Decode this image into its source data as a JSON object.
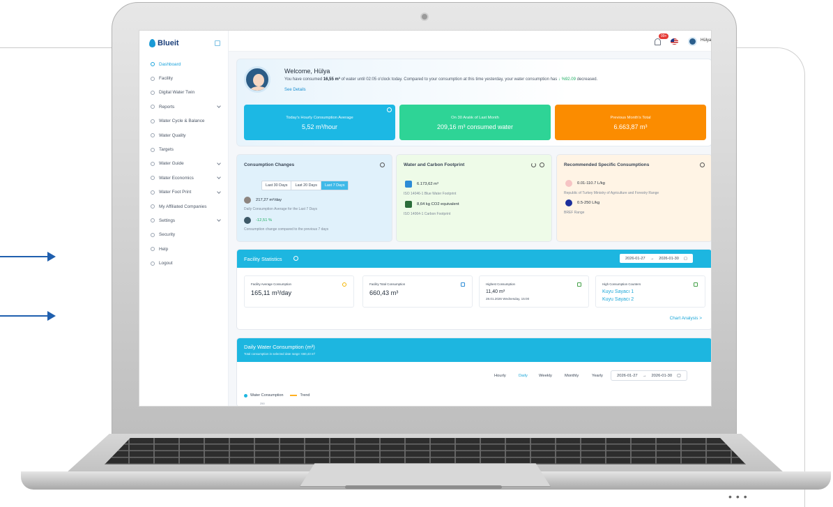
{
  "app": {
    "name": "Blueit"
  },
  "sidebar": {
    "items": [
      {
        "label": "Dashboard",
        "icon": "dashboard-icon",
        "active": true
      },
      {
        "label": "Facility",
        "icon": "facility-icon"
      },
      {
        "label": "Digital Water Twin",
        "icon": "twin-icon"
      },
      {
        "label": "Reports",
        "icon": "reports-icon",
        "expandable": true
      },
      {
        "label": "Water Cycle & Balance",
        "icon": "cycle-icon"
      },
      {
        "label": "Water Quality",
        "icon": "quality-icon"
      },
      {
        "label": "Targets",
        "icon": "targets-icon"
      },
      {
        "label": "Water Guide",
        "icon": "guide-icon",
        "expandable": true
      },
      {
        "label": "Water Economics",
        "icon": "economics-icon",
        "expandable": true
      },
      {
        "label": "Water Foot Print",
        "icon": "footprint-icon",
        "expandable": true
      },
      {
        "label": "My Affiliated Companies",
        "icon": "companies-icon"
      },
      {
        "label": "Settings",
        "icon": "settings-icon",
        "expandable": true
      },
      {
        "label": "Security",
        "icon": "security-icon"
      },
      {
        "label": "Help",
        "icon": "help-icon"
      },
      {
        "label": "Logout",
        "icon": "logout-icon"
      }
    ]
  },
  "topbar": {
    "notifications": "99+",
    "user_name": "Hülya"
  },
  "welcome": {
    "title": "Welcome, Hülya",
    "text_before": "You have consumed ",
    "amount": "16,55 m³",
    "text_middle": " of water until 02:05 o'clock today. Compared to your consumption at this time yesterday, your water consumption has ",
    "change": "↓ %92.09",
    "text_after": " decreased.",
    "see_details": "See Details"
  },
  "stats": [
    {
      "label": "Today's Hourly Consumption Average",
      "value": "5,52 m³/hour"
    },
    {
      "label": "On 30 Aralık of Last Month",
      "value": "209,16 m³ consumed water"
    },
    {
      "label": "Previous Month's Total",
      "value": "6.663,87 m³"
    }
  ],
  "consumption_changes": {
    "title": "Consumption Changes",
    "tabs": [
      "Last 30 Days",
      "Last 20 Days",
      "Last 7 Days"
    ],
    "active_tab": "Last 7 Days",
    "daily_value": "217,27 m³/day",
    "daily_caption": "Daily Consumption Average for the Last 7 Days",
    "change_value": "-12,51 %",
    "change_caption": "Consumption change compared to the previous 7 days"
  },
  "footprint": {
    "title": "Water and Carbon Footprint",
    "blue_value": "6.173,62 m³",
    "blue_caption": "ISO 14046-1 Blue Water Footprint",
    "carbon_value": "8,64 kg CO2 equivalent",
    "carbon_caption": "ISO 14064-1 Carbon Footprint"
  },
  "recommended": {
    "title": "Recommended Specific Consumptions",
    "range1": "0.01-110.7 L/kg",
    "range1_caption": "Republic of Turkey Ministry of Agriculture and Forestry Range",
    "range2": "0.5-250 L/kg",
    "range2_caption": "BREF Range"
  },
  "facility": {
    "title": "Facility Statistics",
    "date_from": "2026-01-27",
    "date_to": "2026-01-30",
    "avg_label": "Facility Average Consumption",
    "avg_value": "165,11 m³/day",
    "total_label": "Facility Total Consumption",
    "total_value": "660,43 m³",
    "highest_label": "Highest Consumption",
    "highest_value": "11,40 m³",
    "highest_date": "28.01.2026 Wednesday, 15:00",
    "counters_label": "High Consumption Counters",
    "counter1": "Kuyu Sayacı 1",
    "counter2": "Kuyu Sayacı 2",
    "chart_analysis": "Chart Analysis >"
  },
  "daily": {
    "title": "Daily Water Consumption (m³)",
    "subtitle": "Total consumption in selected date range: 660,43 m³",
    "periods": [
      "Hourly",
      "Daily",
      "Weekly",
      "Monthly",
      "Yearly"
    ],
    "active_period": "Daily",
    "date_from": "2026-01-27",
    "date_to": "2026-01-30",
    "legend_consumption": "Water Consumption",
    "legend_trend": "Trend",
    "y_tick": "250"
  },
  "colors": {
    "accent": "#1db6e0",
    "green": "#2ed496",
    "orange": "#fb8c00"
  }
}
